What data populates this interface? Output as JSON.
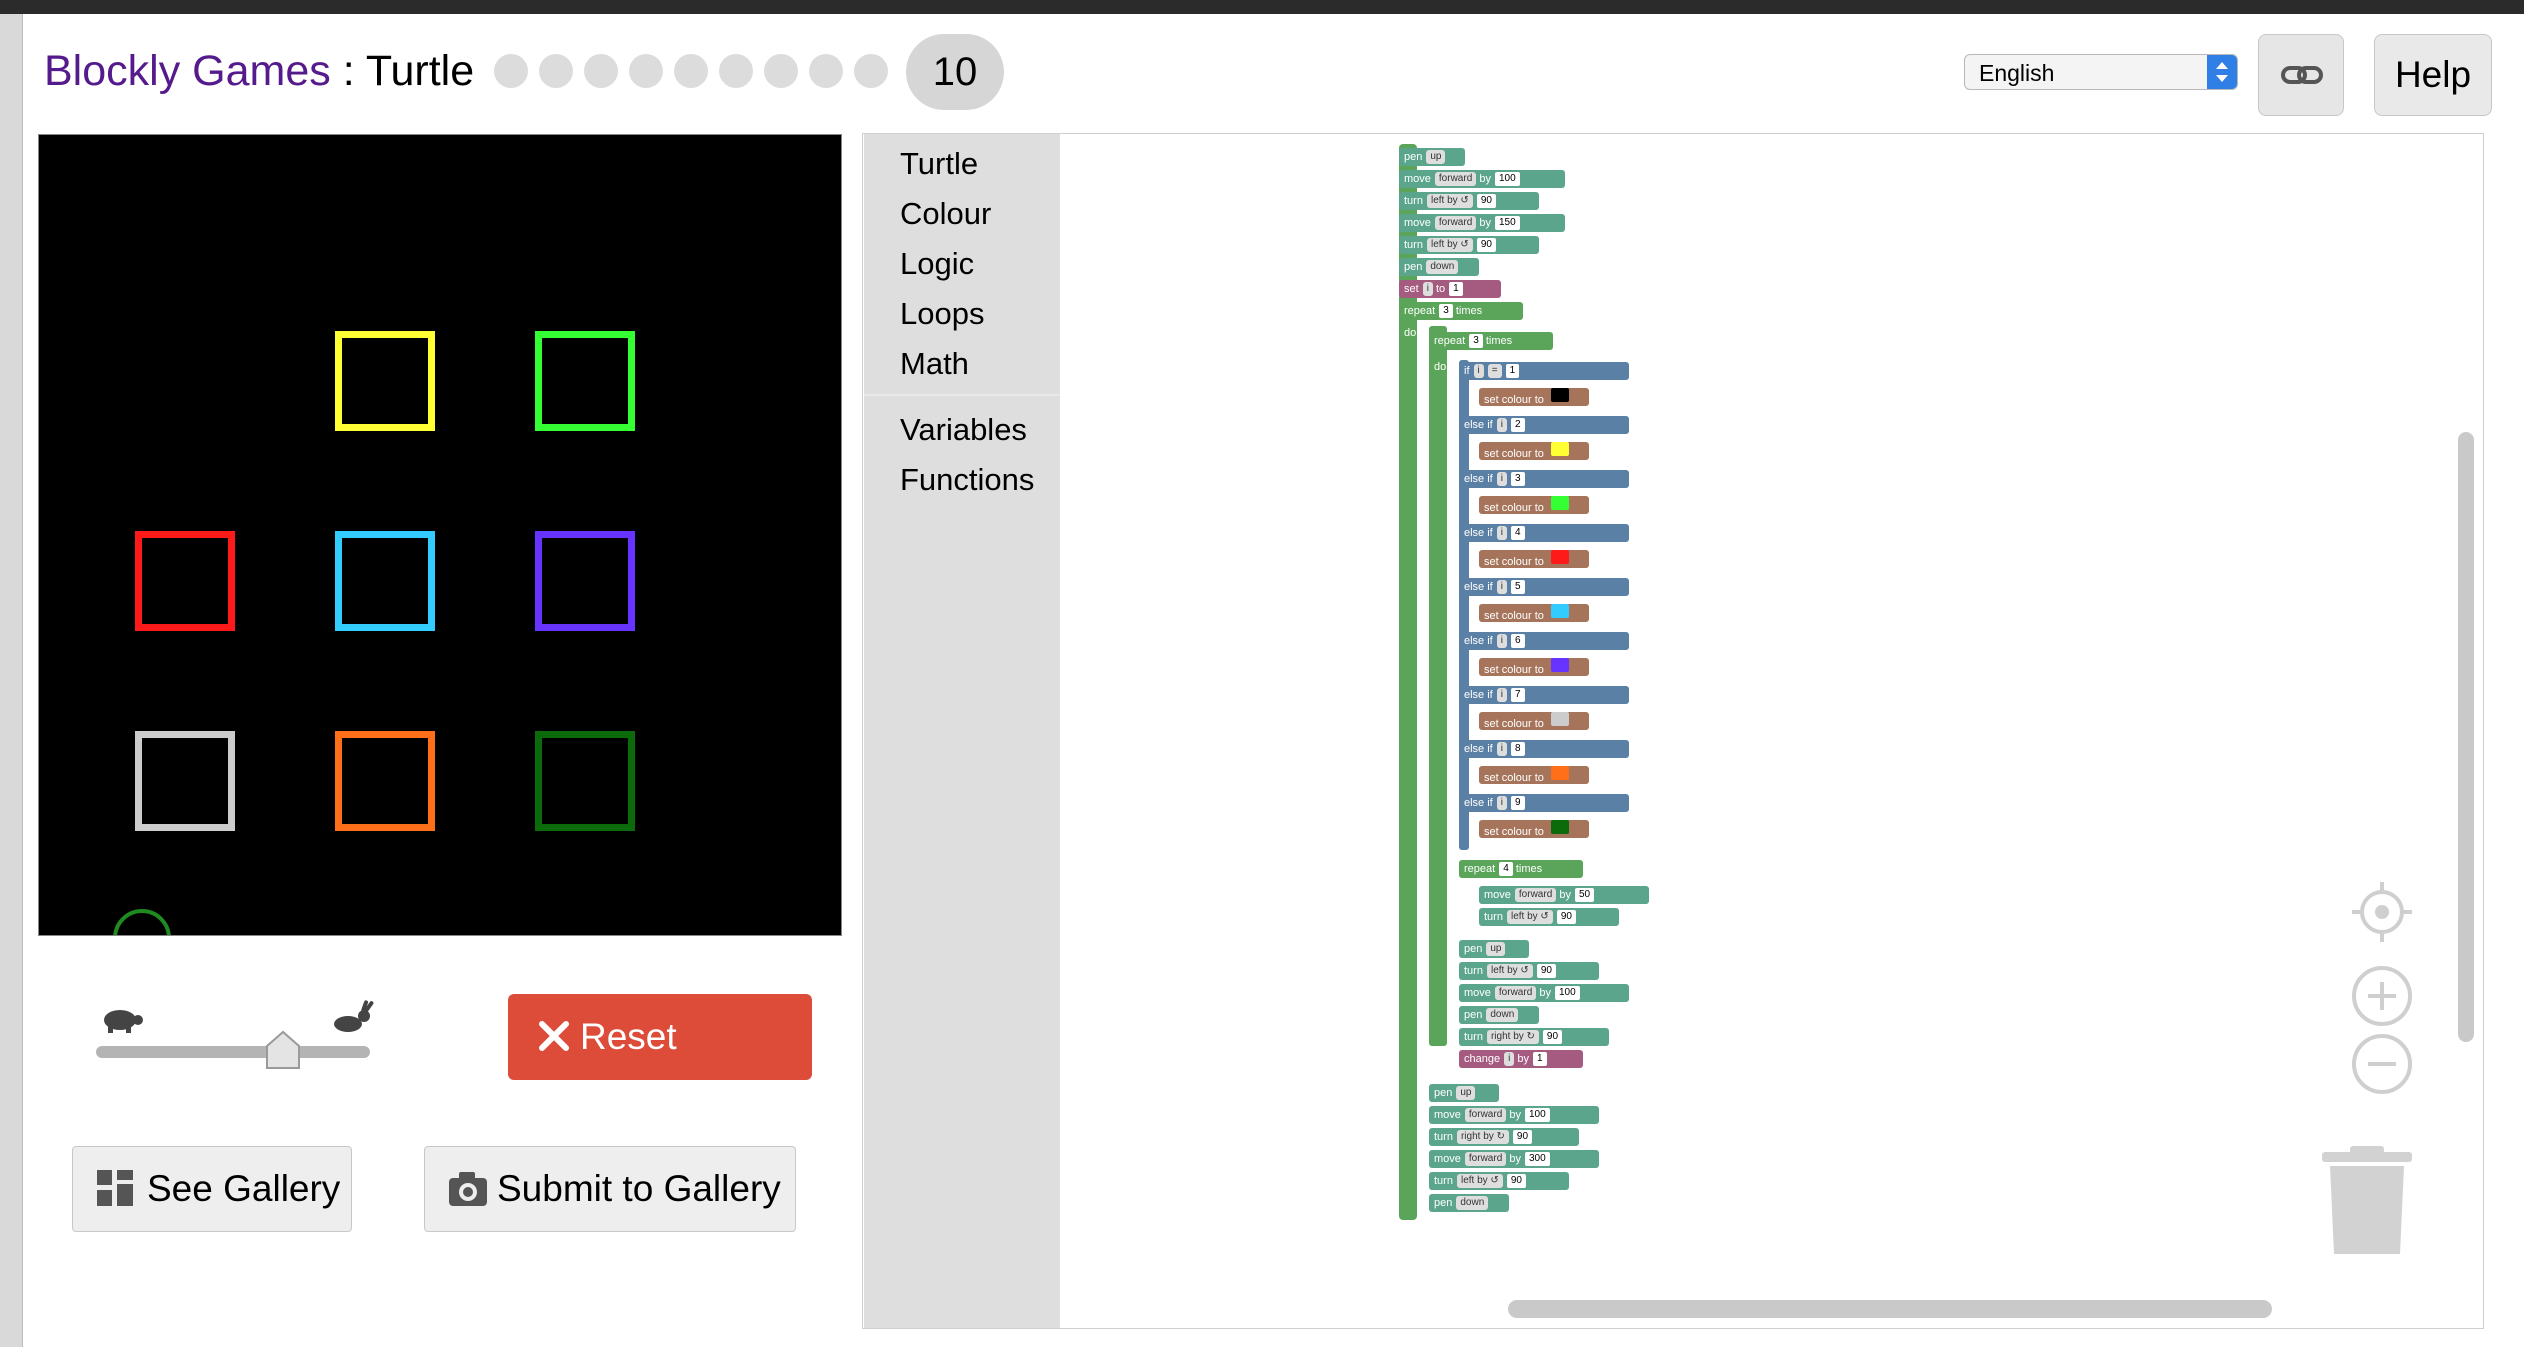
{
  "header": {
    "brand": "Blockly Games",
    "separator": " : ",
    "game": "Turtle",
    "level_count": 10,
    "current_level": "10"
  },
  "language": {
    "selected": "English"
  },
  "buttons": {
    "help": "Help",
    "reset": "Reset",
    "see_gallery": "See Gallery",
    "submit_gallery": "Submit to Gallery",
    "link_icon": "link-icon"
  },
  "toolbox": {
    "categories": [
      "Turtle",
      "Colour",
      "Logic",
      "Loops",
      "Math"
    ],
    "categories2": [
      "Variables",
      "Functions"
    ]
  },
  "canvas": {
    "squares": [
      {
        "row": 1,
        "col": 2,
        "color": "#ffff33"
      },
      {
        "row": 1,
        "col": 3,
        "color": "#33ff33"
      },
      {
        "row": 2,
        "col": 1,
        "color": "#ff1a1a"
      },
      {
        "row": 2,
        "col": 2,
        "color": "#33ccff"
      },
      {
        "row": 2,
        "col": 3,
        "color": "#6633ff"
      },
      {
        "row": 3,
        "col": 1,
        "color": "#cccccc"
      },
      {
        "row": 3,
        "col": 2,
        "color": "#ff6f1a"
      },
      {
        "row": 3,
        "col": 3,
        "color": "#0b6b0b"
      }
    ]
  },
  "code": {
    "pen": "pen",
    "up": "up",
    "down": "down",
    "move": "move",
    "forward": "forward",
    "by": "by",
    "turn": "turn",
    "left_by": "left by ↺",
    "right_by": "right by ↻",
    "set": "set",
    "var_i": "i",
    "to": "to",
    "repeat": "repeat",
    "times": "times",
    "do": "do",
    "if": "if",
    "else_if": "else if",
    "set_colour_to": "set colour to",
    "eq": "=",
    "change": "change",
    "n100": "100",
    "n150": "150",
    "n90": "90",
    "n1": "1",
    "n3": "3",
    "n4": "4",
    "n50": "50",
    "n300": "300",
    "colors": {
      "c1": "#000000",
      "c2": "#ffff33",
      "c3": "#33ff33",
      "c4": "#ff1a1a",
      "c5": "#33ccff",
      "c6": "#6633ff",
      "c7": "#cccccc",
      "c8": "#ff6f1a",
      "c9": "#0b6b0b"
    },
    "conds": [
      "1",
      "2",
      "3",
      "4",
      "5",
      "6",
      "7",
      "8",
      "9"
    ]
  }
}
